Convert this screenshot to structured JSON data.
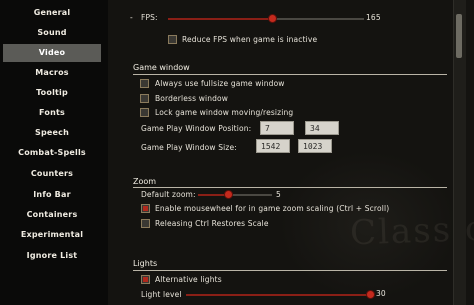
{
  "sidebar": {
    "items": [
      {
        "label": "General"
      },
      {
        "label": "Sound"
      },
      {
        "label": "Video"
      },
      {
        "label": "Macros"
      },
      {
        "label": "Tooltip"
      },
      {
        "label": "Fonts"
      },
      {
        "label": "Speech"
      },
      {
        "label": "Combat-Spells"
      },
      {
        "label": "Counters"
      },
      {
        "label": "Info Bar"
      },
      {
        "label": "Containers"
      },
      {
        "label": "Experimental"
      },
      {
        "label": "Ignore List"
      }
    ],
    "active_index": 2
  },
  "main": {
    "fps": {
      "label": "FPS:",
      "value": "165",
      "reduce_label": "Reduce FPS when game is inactive",
      "reduce_checked": false
    },
    "game_window": {
      "title": "Game window",
      "options": [
        {
          "label": "Always use fullsize game window",
          "checked": false
        },
        {
          "label": "Borderless window",
          "checked": false
        },
        {
          "label": "Lock game window moving/resizing",
          "checked": false
        }
      ],
      "position_label": "Game Play Window Position:",
      "position_x": "7",
      "position_y": "34",
      "size_label": "Game Play Window Size:",
      "size_w": "1542",
      "size_h": "1023"
    },
    "zoom": {
      "title": "Zoom",
      "default_zoom_label": "Default zoom:",
      "default_zoom_value": "5",
      "options": [
        {
          "label": "Enable mousewheel for in game zoom scaling (Ctrl + Scroll)",
          "checked": true
        },
        {
          "label": "Releasing Ctrl Restores Scale",
          "checked": false
        }
      ]
    },
    "lights": {
      "title": "Lights",
      "options": [
        {
          "label": "Alternative lights",
          "checked": true
        }
      ],
      "light_level_label": "Light level",
      "light_level_value": "30"
    },
    "watermark": "ClassicUO"
  },
  "colors": {
    "accent": "#c42a1d",
    "active_tab": "#5b5b57",
    "field_bg": "#d6d3cb"
  }
}
